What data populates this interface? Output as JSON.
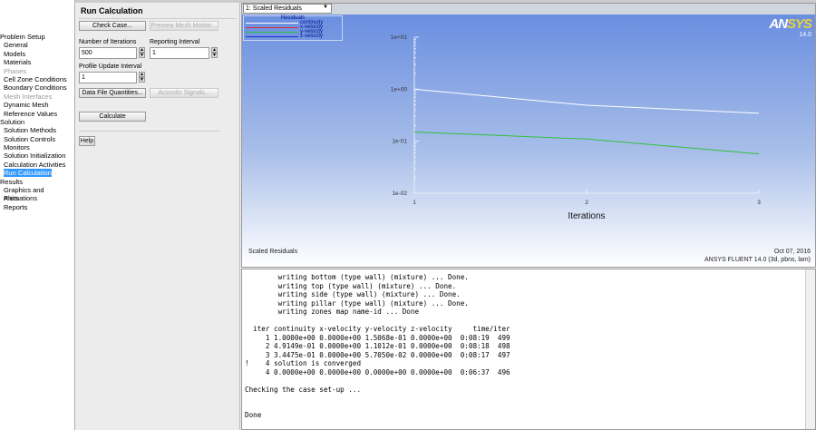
{
  "tree": [
    {
      "label": "Problem Setup",
      "type": "g"
    },
    {
      "label": "General",
      "type": "i"
    },
    {
      "label": "Models",
      "type": "i"
    },
    {
      "label": "Materials",
      "type": "i"
    },
    {
      "label": "Phases",
      "type": "i",
      "disabled": true
    },
    {
      "label": "Cell Zone Conditions",
      "type": "i"
    },
    {
      "label": "Boundary Conditions",
      "type": "i"
    },
    {
      "label": "Mesh Interfaces",
      "type": "i",
      "disabled": true
    },
    {
      "label": "Dynamic Mesh",
      "type": "i"
    },
    {
      "label": "Reference Values",
      "type": "i"
    },
    {
      "label": "Solution",
      "type": "g"
    },
    {
      "label": "Solution Methods",
      "type": "i"
    },
    {
      "label": "Solution Controls",
      "type": "i"
    },
    {
      "label": "Monitors",
      "type": "i"
    },
    {
      "label": "Solution Initialization",
      "type": "i"
    },
    {
      "label": "Calculation Activities",
      "type": "i"
    },
    {
      "label": "Run Calculation",
      "type": "i",
      "selected": true
    },
    {
      "label": "Results",
      "type": "g"
    },
    {
      "label": "Graphics and Animations",
      "type": "i"
    },
    {
      "label": "Plots",
      "type": "i"
    },
    {
      "label": "Reports",
      "type": "i"
    }
  ],
  "panel": {
    "title": "Run Calculation",
    "check_case": "Check Case...",
    "preview_mesh": "Preview Mesh Motion...",
    "iterations_label": "Number of Iterations",
    "iterations_value": "500",
    "reporting_label": "Reporting Interval",
    "reporting_value": "1",
    "profile_label": "Profile Update Interval",
    "profile_value": "1",
    "data_file": "Data File Quantities...",
    "acoustic": "Acoustic Signals...",
    "calculate": "Calculate",
    "help": "Help"
  },
  "graphics": {
    "window_select": "1: Scaled Residuals",
    "logo": "ANSYS",
    "version": "14.0",
    "footer_left": "Scaled Residuals",
    "date": "Oct 07, 2016",
    "product": "ANSYS FLUENT 14.0 (3d, pbns, lam)"
  },
  "chart_data": {
    "type": "line",
    "title": "Residuals",
    "xlabel": "Iterations",
    "ylabel": "",
    "x": [
      1,
      2,
      3
    ],
    "xlim": [
      1,
      3
    ],
    "ylim": [
      0.01,
      10
    ],
    "yscale": "log",
    "yticks": [
      "1e+01",
      "1e+00",
      "1e-01",
      "1e-02"
    ],
    "xticks": [
      "1",
      "2",
      "3"
    ],
    "legend": "top-left",
    "series": [
      {
        "name": "continuity",
        "color": "#ffffff",
        "values": [
          1.0,
          0.49149,
          0.34475
        ]
      },
      {
        "name": "x-velocity",
        "color": "#e03030",
        "values": [
          0,
          0,
          0
        ]
      },
      {
        "name": "y-velocity",
        "color": "#30c040",
        "values": [
          0.15068,
          0.11012,
          0.05705
        ]
      },
      {
        "name": "z-velocity",
        "color": "#2030d0",
        "values": [
          0,
          0,
          0
        ]
      }
    ]
  },
  "console": {
    "lines": [
      "        writing bottom (type wall) (mixture) ... Done.",
      "        writing top (type wall) (mixture) ... Done.",
      "        writing side (type wall) (mixture) ... Done.",
      "        writing pillar (type wall) (mixture) ... Done.",
      "        writing zones map name-id ... Done",
      "",
      "  iter continuity x-velocity y-velocity z-velocity     time/iter",
      "     1 1.0000e+00 0.0000e+00 1.5068e-01 0.0000e+00  0:08:19  499",
      "     2 4.9149e-01 0.0000e+00 1.1012e-01 0.0000e+00  0:08:18  498",
      "     3 3.4475e-01 0.0000e+00 5.7050e-02 0.0000e+00  0:08:17  497",
      "!    4 solution is converged",
      "     4 0.0000e+00 0.0000e+00 0.0000e+00 0.0000e+00  0:06:37  496",
      "",
      "Checking the case set-up ...",
      "",
      "",
      "Done"
    ]
  }
}
